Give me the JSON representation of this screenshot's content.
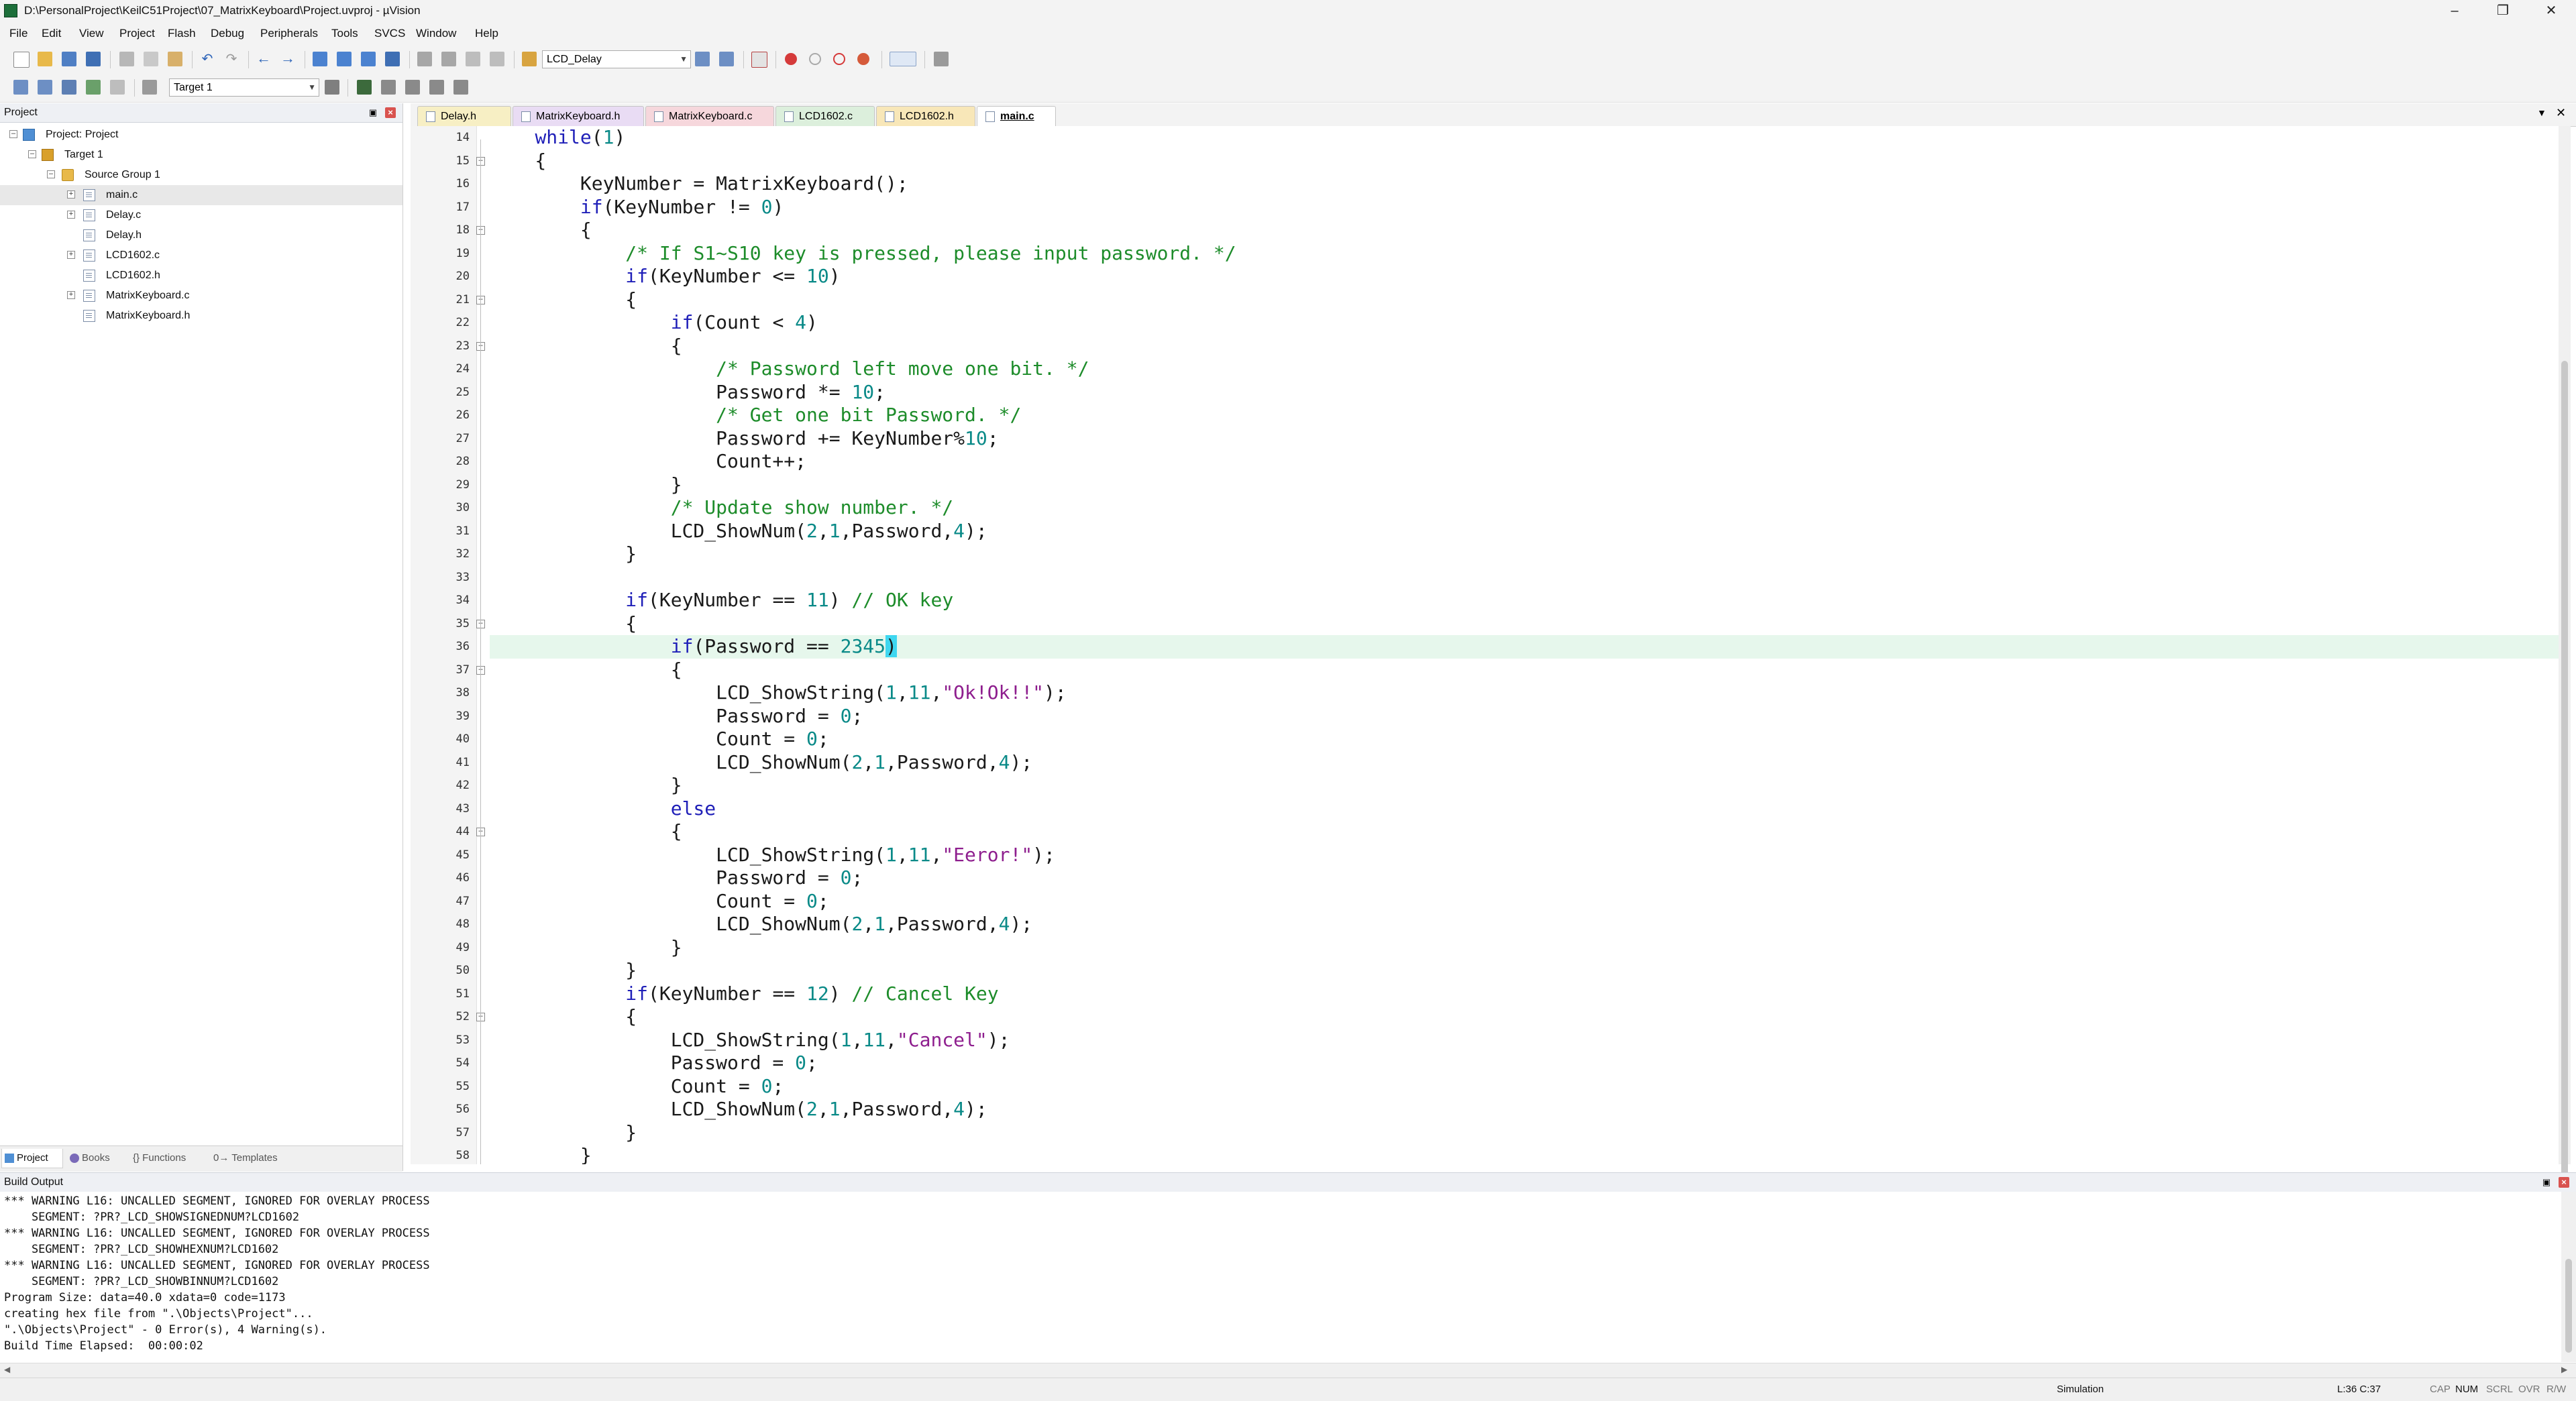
{
  "window": {
    "title": "D:\\PersonalProject\\KeilC51Project\\07_MatrixKeyboard\\Project.uvproj - µVision"
  },
  "menu": [
    "File",
    "Edit",
    "View",
    "Project",
    "Flash",
    "Debug",
    "Peripherals",
    "Tools",
    "SVCS",
    "Window",
    "Help"
  ],
  "toolbar1": {
    "find_combo": "LCD_Delay"
  },
  "toolbar2": {
    "target_combo": "Target 1"
  },
  "project_panel": {
    "title": "Project",
    "tree": {
      "root": "Project: Project",
      "target": "Target 1",
      "group": "Source Group 1",
      "files": [
        "main.c",
        "Delay.c",
        "Delay.h",
        "LCD1602.c",
        "LCD1602.h",
        "MatrixKeyboard.c",
        "MatrixKeyboard.h"
      ]
    },
    "tabs": [
      "Project",
      "Books",
      "{} Functions",
      "0→ Templates"
    ]
  },
  "editor": {
    "tabs": [
      {
        "label": "Delay.h",
        "color": "#f7efc4"
      },
      {
        "label": "MatrixKeyboard.h",
        "color": "#e9dcf4"
      },
      {
        "label": "MatrixKeyboard.c",
        "color": "#f6d7dc"
      },
      {
        "label": "LCD1602.c",
        "color": "#dcefdc"
      },
      {
        "label": "LCD1602.h",
        "color": "#f8e7b8"
      },
      {
        "label": "main.c",
        "color": "#ffffff"
      }
    ],
    "active_tab": "main.c",
    "current_line": 36,
    "line_numbers": [
      "14",
      "15",
      "16",
      "17",
      "18",
      "19",
      "20",
      "21",
      "22",
      "23",
      "24",
      "25",
      "26",
      "27",
      "28",
      "29",
      "30",
      "31",
      "32",
      "33",
      "34",
      "35",
      "36",
      "37",
      "38",
      "39",
      "40",
      "41",
      "42",
      "43",
      "44",
      "45",
      "46",
      "47",
      "48",
      "49",
      "50",
      "51",
      "52",
      "53",
      "54",
      "55",
      "56",
      "57",
      "58"
    ],
    "code": [
      "    while(1)",
      "    {",
      "        KeyNumber = MatrixKeyboard();",
      "        if(KeyNumber != 0)",
      "        {",
      "            /* If S1~S10 key is pressed, please input password. */",
      "            if(KeyNumber <= 10)",
      "            {",
      "                if(Count < 4)",
      "                {",
      "                    /* Password left move one bit. */",
      "                    Password *= 10;",
      "                    /* Get one bit Password. */",
      "                    Password += KeyNumber%10;",
      "                    Count++;",
      "                }",
      "                /* Update show number. */",
      "                LCD_ShowNum(2,1,Password,4);",
      "            }",
      "",
      "            if(KeyNumber == 11) // OK key",
      "            {",
      "                if(Password == 2345)",
      "                {",
      "                    LCD_ShowString(1,11,\"Ok!Ok!!\");",
      "                    Password = 0;",
      "                    Count = 0;",
      "                    LCD_ShowNum(2,1,Password,4);",
      "                }",
      "                else",
      "                {",
      "                    LCD_ShowString(1,11,\"Eeror!\");",
      "                    Password = 0;",
      "                    Count = 0;",
      "                    LCD_ShowNum(2,1,Password,4);",
      "                }",
      "            }",
      "            if(KeyNumber == 12) // Cancel Key",
      "            {",
      "                LCD_ShowString(1,11,\"Cancel\");",
      "                Password = 0;",
      "                Count = 0;",
      "                LCD_ShowNum(2,1,Password,4);",
      "            }",
      "        }"
    ]
  },
  "build_output": {
    "title": "Build Output",
    "lines": [
      "*** WARNING L16: UNCALLED SEGMENT, IGNORED FOR OVERLAY PROCESS",
      "    SEGMENT: ?PR?_LCD_SHOWSIGNEDNUM?LCD1602",
      "*** WARNING L16: UNCALLED SEGMENT, IGNORED FOR OVERLAY PROCESS",
      "    SEGMENT: ?PR?_LCD_SHOWHEXNUM?LCD1602",
      "*** WARNING L16: UNCALLED SEGMENT, IGNORED FOR OVERLAY PROCESS",
      "    SEGMENT: ?PR?_LCD_SHOWBINNUM?LCD1602",
      "Program Size: data=40.0 xdata=0 code=1173",
      "creating hex file from \".\\Objects\\Project\"...",
      "\".\\Objects\\Project\" - 0 Error(s), 4 Warning(s).",
      "Build Time Elapsed:  00:00:02"
    ]
  },
  "status": {
    "mode": "Simulation",
    "position": "L:36 C:37",
    "indicators": [
      "CAP",
      "NUM",
      "SCRL",
      "OVR",
      "R/W"
    ],
    "active_indicators": [
      "NUM"
    ]
  }
}
